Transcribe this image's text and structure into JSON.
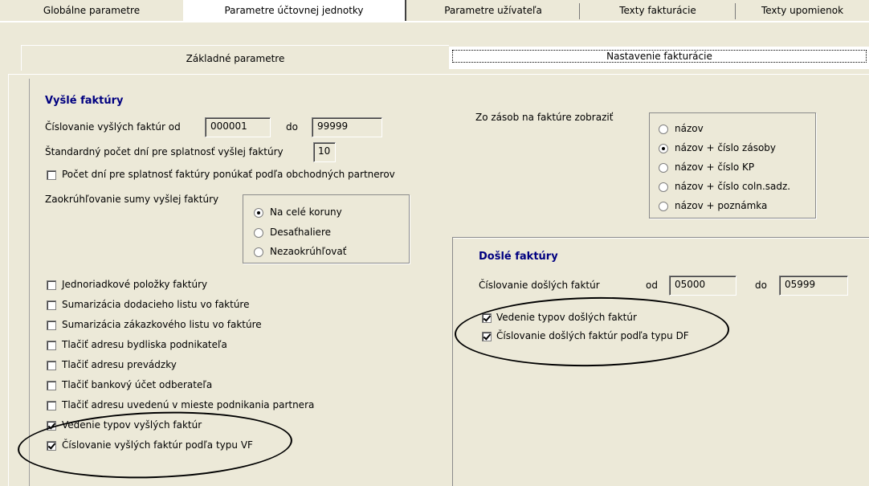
{
  "tabs": [
    "Globálne parametre",
    "Parametre účtovnej jednotky",
    "Parametre užívateľa",
    "Texty fakturácie",
    "Texty upomienok"
  ],
  "subtabs": [
    "Základné parametre",
    "Nastavenie fakturácie"
  ],
  "issued": {
    "title": "Vyšlé faktúry",
    "numbering_label": "Číslovanie vyšlých faktúr od",
    "from": "000001",
    "to_label": "do",
    "to": "99999",
    "due_days_label": "Štandardný počet dní pre splatnosť vyšlej faktúry",
    "due_days": "10",
    "partner_days_label": "Počet dní pre splatnosť faktúry ponúkať podľa obchodných partnerov",
    "rounding_label": "Zaokrúhľovanie sumy vyšlej faktúry",
    "rounding_options": [
      "Na celé koruny",
      "Desaťhaliere",
      "Nezaokrúhľovať"
    ],
    "options": [
      {
        "label": "Jednoriadkové položky faktúry",
        "checked": false
      },
      {
        "label": "Sumarizácia dodacieho listu vo faktúre",
        "checked": false
      },
      {
        "label": "Sumarizácia zákazkového listu vo faktúre",
        "checked": false
      },
      {
        "label": "Tlačiť adresu bydliska podnikateľa",
        "checked": false
      },
      {
        "label": "Tlačiť adresu prevádzky",
        "checked": false
      },
      {
        "label": "Tlačiť bankový účet odberateľa",
        "checked": false
      },
      {
        "label": "Tlačiť adresu uvedenú v mieste podnikania partnera",
        "checked": false
      },
      {
        "label": "Vedenie typov vyšlých faktúr",
        "checked": true
      },
      {
        "label": "Číslovanie vyšlých faktúr podľa typu VF",
        "checked": true
      }
    ]
  },
  "stock": {
    "label": "Zo zásob na faktúre zobraziť",
    "options": [
      "názov",
      "názov + číslo zásoby",
      "názov + číslo KP",
      "názov + číslo coln.sadz.",
      "názov + poznámka"
    ],
    "selected": 1
  },
  "received": {
    "title": "Došlé faktúry",
    "numbering_label": "Číslovanie došlých faktúr",
    "from_label": "od",
    "from": "05000",
    "to_label": "do",
    "to": "05999",
    "types_label": "Vedenie typov došlých faktúr",
    "numbering_by_type_label": "Číslovanie došlých faktúr podľa typu DF"
  }
}
